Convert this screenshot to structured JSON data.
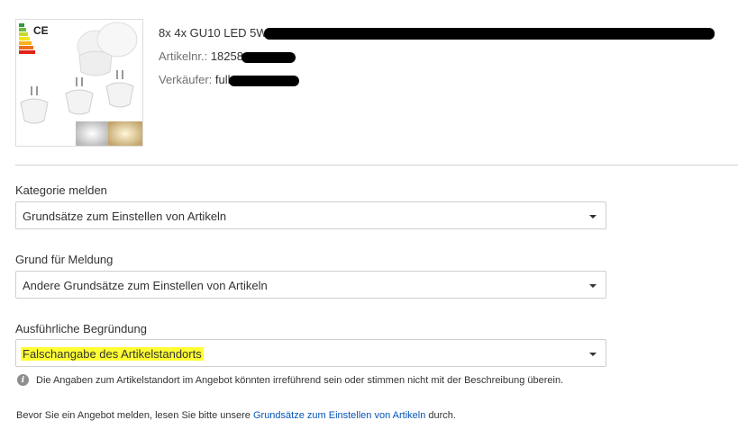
{
  "product": {
    "title": "8x 4x GU10 LED 5W",
    "article_label": "Artikelnr.:",
    "article_value": "18258",
    "seller_label": "Verkäufer:",
    "seller_value": "full"
  },
  "thumbnail": {
    "icon_name": "led-bulb-product-image",
    "badge_text": "CE"
  },
  "form": {
    "category": {
      "label": "Kategorie melden",
      "value": "Grundsätze zum Einstellen von Artikeln"
    },
    "reason": {
      "label": "Grund für Meldung",
      "value": "Andere Grundsätze zum Einstellen von Artikeln"
    },
    "detail": {
      "label": "Ausführliche Begründung",
      "value": "Falschangabe des Artikelstandorts",
      "highlight_color": "#ffff33"
    }
  },
  "info": {
    "icon": "i",
    "text": "Die Angaben zum Artikelstandort im Angebot könnten irreführend sein oder stimmen nicht mit der Beschreibung überein."
  },
  "footer": {
    "prefix": "Bevor Sie ein Angebot melden, lesen Sie bitte unsere",
    "link_text": "Grundsätze zum Einstellen von Artikeln",
    "suffix": "durch.",
    "link_color": "#0654ba"
  }
}
